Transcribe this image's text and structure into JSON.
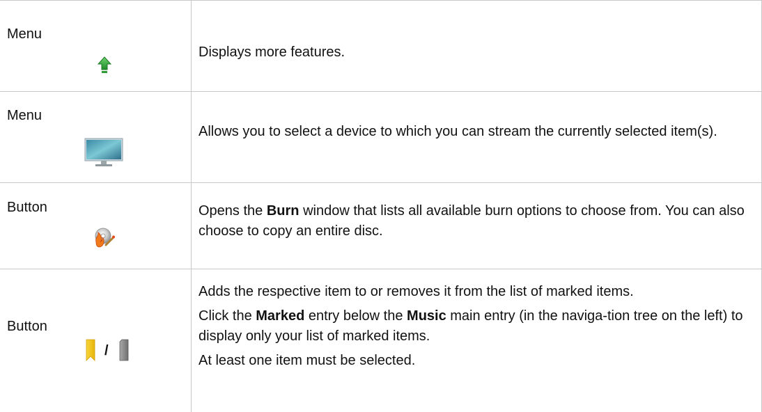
{
  "rows": [
    {
      "type": "Menu",
      "icon": "green-up-arrow-icon",
      "description": "Displays more features."
    },
    {
      "type": "Menu",
      "icon": "monitor-icon",
      "description": "Allows you to select a device to which you can stream the currently selected item(s)."
    },
    {
      "type": "Button",
      "icon": "burn-disc-icon",
      "description_parts": [
        "Opens the ",
        "Burn",
        " window that lists all available burn options to choose from. You can also choose to copy an entire disc."
      ]
    },
    {
      "type": "Button",
      "icon": "bookmark-yellow-icon / bookmark-gray-icon",
      "separator": "/",
      "description_p1": "Adds the respective item to or removes it from the list of marked items.",
      "description_p2_parts": [
        "Click the ",
        "Marked",
        " entry below the ",
        "Music",
        " main entry (in the naviga-tion tree on the left) to display only your list of marked items."
      ],
      "description_p3": "At least one item must be selected."
    }
  ],
  "colors": {
    "grid": "#c8c8c8",
    "arrow_green": "#3aa83a",
    "bookmark_yellow": "#f2c51c",
    "bookmark_gray": "#8a8a8a"
  }
}
